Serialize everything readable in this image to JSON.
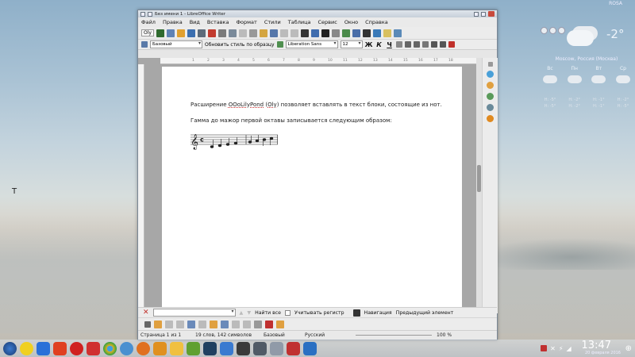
{
  "desktop": {
    "rosa_label": "ROSA",
    "text_cursor": "T"
  },
  "weather": {
    "current_temp": "-2°",
    "city": "Moscow, Россия (Москва)",
    "days": [
      {
        "name": "Вс",
        "low1": "Н: -5°",
        "low2": "Н: -5°"
      },
      {
        "name": "Пн",
        "low1": "Н: -2°",
        "low2": "Н: -2°"
      },
      {
        "name": "Вт",
        "low1": "Н: -1°",
        "low2": "Н: -1°"
      },
      {
        "name": "Ср",
        "low1": "Н: -2°",
        "low2": "Н: -5°"
      }
    ]
  },
  "window": {
    "title": "Без имени 1 - LibreOffice Writer",
    "menu": [
      "Файл",
      "Правка",
      "Вид",
      "Вставка",
      "Формат",
      "Стили",
      "Таблица",
      "Сервис",
      "Окно",
      "Справка"
    ],
    "oly_label": "Oly",
    "style_value": "Базовый",
    "update_style": "Обновить стиль по образцу",
    "font_value": "Liberation Sans",
    "size_value": "12",
    "bold": "Ж",
    "italic": "К",
    "underline": "Ч",
    "ruler_marks": [
      "1",
      "2",
      "3",
      "4",
      "5",
      "6",
      "7",
      "8",
      "9",
      "10",
      "11",
      "12",
      "13",
      "14",
      "15",
      "16",
      "17",
      "18"
    ]
  },
  "document": {
    "para1_pre": "Расширение ",
    "para1_link": "OOoLilyPond",
    "para1_mid": " (",
    "para1_oly": "Oly",
    "para1_post": ") позволяет вставлять в текст блоки, состоящие из нот.",
    "para2": "Гамма до мажор первой октавы записывается следующим образом:"
  },
  "findbar": {
    "find_all": "Найти все",
    "match_case": "Учитывать регистр",
    "navigation": "Навигация",
    "previous": "Предыдущий элемент"
  },
  "status": {
    "page": "Страница 1 из 1",
    "words": "19 слов, 142 символов",
    "style": "Базовый",
    "lang": "Русский",
    "zoom": "100 %"
  },
  "taskbar": {
    "clock": "13:47",
    "date": "20 февраля 2016"
  },
  "colors": {
    "accent": "#2a6fc2",
    "close": "#c84a3c"
  }
}
